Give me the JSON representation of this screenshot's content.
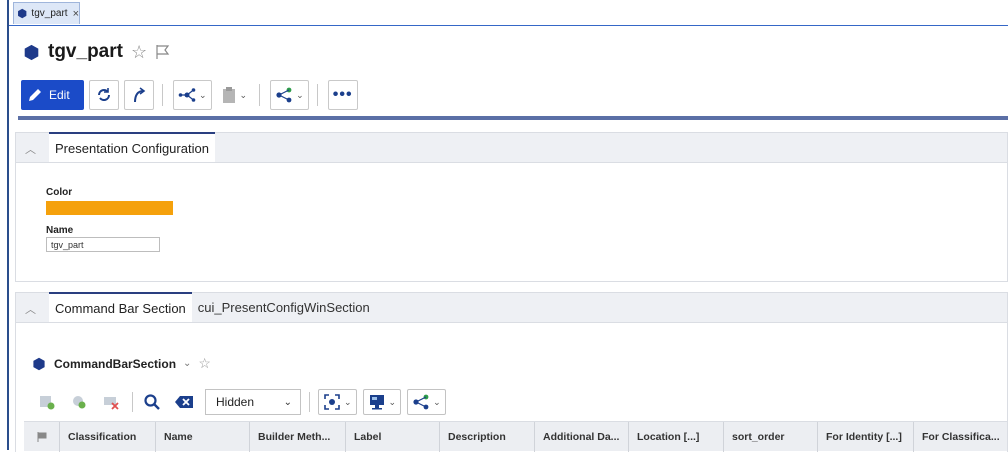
{
  "tab": {
    "label": "tgv_part",
    "close": "×"
  },
  "header": {
    "title": "tgv_part"
  },
  "toolbar": {
    "edit_label": "Edit",
    "more": "•••"
  },
  "sections": {
    "presentation": {
      "tab_label": "Presentation Configuration",
      "color_label": "Color",
      "color_value": "#f5a10c",
      "name_label": "Name",
      "name_value": "tgv_part"
    },
    "command_bar": {
      "tabs": [
        "Command Bar Section",
        "cui_PresentConfigWinSection"
      ],
      "title": "CommandBarSection",
      "filter_value": "Hidden",
      "columns": [
        "Classification",
        "Name",
        "Builder Meth...",
        "Label",
        "Description",
        "Additional Da...",
        "Location [...]",
        "sort_order",
        "For Identity [...]",
        "For Classifica..."
      ]
    }
  },
  "colors": {
    "accent": "#1b4bc8",
    "hex_icon": "#1e3a8a",
    "bar": "#5b6fa6"
  }
}
